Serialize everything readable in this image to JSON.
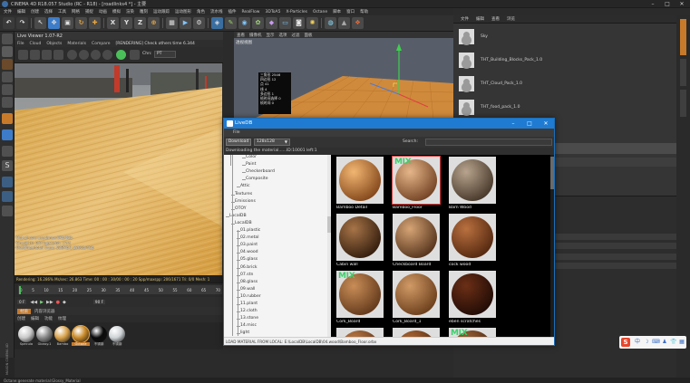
{
  "titlebar": {
    "title": "CINEMA 4D R18.057 Studio (RC - R18) - [roadlinks4 *] - 主要",
    "min": "–",
    "max": "□",
    "close": "✕"
  },
  "menubar": [
    "文件",
    "编辑",
    "创建",
    "选择",
    "工具",
    "网格",
    "捕捉",
    "动画",
    "模拟",
    "渲染",
    "雕刻",
    "运动跟踪",
    "运动图形",
    "角色",
    "流水线",
    "插件",
    "RealFlow",
    "3DToA5",
    "X-Particles",
    "Octane",
    "脚本",
    "窗口",
    "帮助"
  ],
  "toolbar": {
    "x_label": "X",
    "y_label": "Y",
    "z_label": "Z"
  },
  "live_viewer": {
    "title": "Live Viewer 1.07-R2",
    "menu": [
      "File",
      "Cloud",
      "Objects",
      "Materials",
      "Compare"
    ],
    "rendering_msg": "[RENDERING] Check others time 6.344",
    "chn_label": "Chn:",
    "chn_value": "PT",
    "stats": [
      "Out-of-core used/max:0Kb/4Gb",
      "Grey8/16: 0/0        Rgb32/64: 27/4",
      "Used/free/total vram: 588Mb/1.676Gb/4Gb",
      "Rendering: 16.286%   Ms/sec: 26.863   Time: 00 : 00 : 30/00 : 00 : 20   Spp/maxspp: 206/1671   Tri: 0/0   Mesh: 1"
    ],
    "rendering_pct": "Rendering: 16.286%"
  },
  "timeline": {
    "ticks": [
      "0",
      "5",
      "10",
      "15",
      "20",
      "25",
      "30",
      "35",
      "40",
      "45",
      "50",
      "55",
      "60",
      "65",
      "70"
    ],
    "frame_start": "0 F",
    "frame_end": "90 F"
  },
  "material_manager": {
    "tabs": [
      "材质",
      "内容浏览器"
    ],
    "menu": [
      "创建",
      "编辑",
      "功能",
      "纹理"
    ],
    "materials": [
      {
        "name": "Specula",
        "color": "#c9c9c9"
      },
      {
        "name": "Glossy.1",
        "color": "#8a8a8a"
      },
      {
        "name": "Bambo",
        "color": "#d9a24a"
      },
      {
        "name": "Octane",
        "color": "#c98a2a"
      },
      {
        "name": "不锈钢",
        "color": "#0a0a0a"
      },
      {
        "name": "不锈钢",
        "color": "#cfd3d6"
      }
    ]
  },
  "statusbar": "Octane:generate material:Glossy_Material",
  "sidebar_logo": "MAXON CINEMA 4D",
  "editor_viewport": {
    "menu": [
      "查看",
      "摄像机",
      "显示",
      "选项",
      "过滤",
      "面板"
    ],
    "label": "透视视图",
    "hud": [
      "三角形  2546",
      "四边形  12",
      "点      41",
      "线      4",
      "多边形   1",
      "帧时间选择 0",
      "帧时间  0"
    ]
  },
  "right_panel": {
    "tabs": [
      "文件",
      "编辑",
      "查看",
      "浏览"
    ],
    "items": [
      "Sky",
      "THT_Building_Blocks_Pack_1.0",
      "THT_Cloud_Pack_1.0",
      "THT_food_pack_1.0"
    ]
  },
  "livedb": {
    "title": "LiveDB",
    "menu": "File",
    "download_label": "Download",
    "size_value": "128x128",
    "search_label": "Search:",
    "progress": "Downloading the material......ID:10001 left:1",
    "tree": [
      {
        "label": "Color",
        "indent": 2
      },
      {
        "label": "Paint",
        "indent": 2
      },
      {
        "label": "Checkerboard",
        "indent": 2
      },
      {
        "label": "Composite",
        "indent": 2
      },
      {
        "label": "Attic",
        "indent": 1
      },
      {
        "label": "Textures",
        "indent": 0
      },
      {
        "label": "Emissions",
        "indent": 0
      },
      {
        "label": "OTOY",
        "indent": 0
      },
      {
        "label": "LocalDB",
        "indent": -1
      },
      {
        "label": "LocalDB",
        "indent": 0
      },
      {
        "label": "01.plastic",
        "indent": 1
      },
      {
        "label": "02.metal",
        "indent": 1
      },
      {
        "label": "03.paint",
        "indent": 1
      },
      {
        "label": "04.wood",
        "indent": 1
      },
      {
        "label": "05.glass",
        "indent": 1
      },
      {
        "label": "06.brick",
        "indent": 1
      },
      {
        "label": "07.stn",
        "indent": 1
      },
      {
        "label": "08.glass",
        "indent": 1
      },
      {
        "label": "09.wall",
        "indent": 1
      },
      {
        "label": "10.rubber",
        "indent": 1
      },
      {
        "label": "11.plant",
        "indent": 1
      },
      {
        "label": "12.cloth",
        "indent": 1
      },
      {
        "label": "13.stone",
        "indent": 1
      },
      {
        "label": "14.misc",
        "indent": 1
      },
      {
        "label": "light",
        "indent": 1
      }
    ],
    "materials": [
      {
        "name": "Bamboo Detail",
        "mix": "",
        "c1": "#f2b672",
        "c2": "#7a3e14"
      },
      {
        "name": "Bamboo_Floor",
        "mix": "MIX",
        "c1": "#e6b68a",
        "c2": "#6a3a1c",
        "selected": true
      },
      {
        "name": "Barn Wood",
        "mix": "",
        "c1": "#b8a48e",
        "c2": "#3e2f22"
      },
      {
        "name": "Cabin wall",
        "mix": "",
        "c1": "#a77448",
        "c2": "#2a1608"
      },
      {
        "name": "Checkboard Board",
        "mix": "",
        "c1": "#d6a475",
        "c2": "#4a2a14"
      },
      {
        "name": "cock wood",
        "mix": "",
        "c1": "#b9703f",
        "c2": "#4c220c"
      },
      {
        "name": "Cork_Board",
        "mix": "MIX",
        "c1": "#c98d57",
        "c2": "#5a3216"
      },
      {
        "name": "Cork_Board_1",
        "mix": "",
        "c1": "#d19a66",
        "c2": "#633715"
      },
      {
        "name": "eben scratches",
        "mix": "",
        "c1": "#6b2f16",
        "c2": "#1a0804"
      },
      {
        "name": "",
        "mix": "",
        "c1": "#c7834d",
        "c2": "#4c250e"
      },
      {
        "name": "",
        "mix": "",
        "c1": "#b86f38",
        "c2": "#3e1c08"
      },
      {
        "name": "",
        "mix": "MIX",
        "c1": "#a56a3c",
        "c2": "#3a1c0a"
      }
    ],
    "status": "LOAD MATERIAL FROM LOCAL: E:\\LocalDB\\LocalDB\\04.wood\\Bamboo_Floor.orbx"
  },
  "tray": {
    "s_label": "S",
    "icons": [
      "中",
      "☽",
      "⌨",
      "♟",
      "👕",
      "▦"
    ]
  }
}
